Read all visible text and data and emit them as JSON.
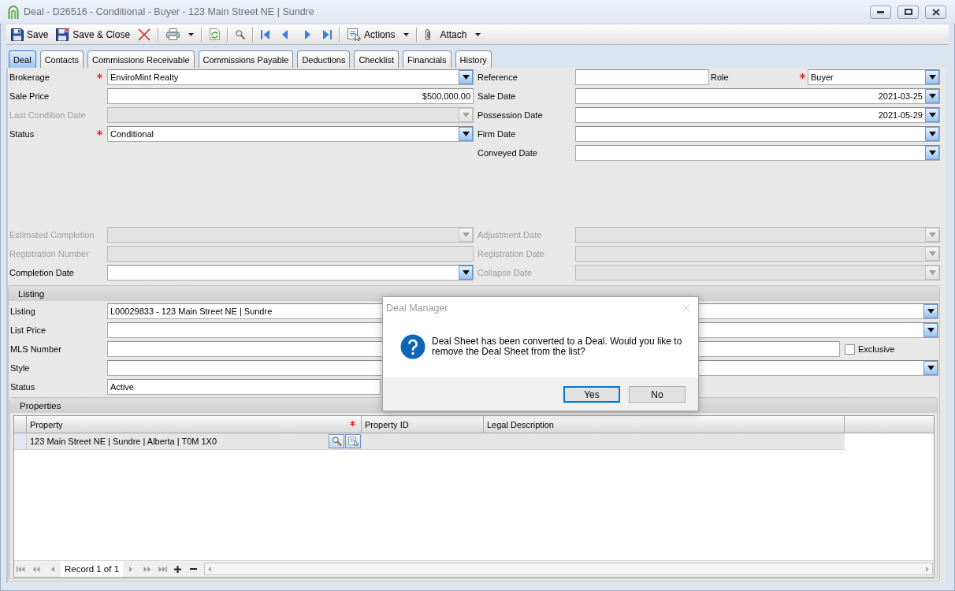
{
  "window": {
    "title": "Deal - D26516 - Conditional - Buyer - 123 Main Street NE | Sundre"
  },
  "toolbar": {
    "groups": [
      [
        {
          "kind": "save",
          "label": "Save",
          "dropdown": false
        },
        {
          "kind": "saveclose",
          "label": "Save & Close",
          "dropdown": false
        },
        {
          "kind": "delete",
          "dropdown": false
        }
      ],
      [
        {
          "kind": "print",
          "dropdown": true
        }
      ],
      [
        {
          "kind": "refresh",
          "dropdown": false
        }
      ],
      [
        {
          "kind": "find",
          "dropdown": false
        }
      ],
      [
        {
          "kind": "first",
          "dropdown": false
        },
        {
          "kind": "previous",
          "dropdown": false
        },
        {
          "kind": "next",
          "dropdown": false
        },
        {
          "kind": "last",
          "dropdown": false
        }
      ],
      [
        {
          "kind": "actions",
          "label": "Actions",
          "dropdown": true
        }
      ],
      [
        {
          "kind": "attach",
          "label": "Attach",
          "dropdown": true
        }
      ]
    ]
  },
  "tabs": [
    {
      "label": "Deal",
      "selected": true
    },
    {
      "label": "Contacts",
      "selected": false
    },
    {
      "label": "Commissions Receivable",
      "selected": false
    },
    {
      "label": "Commissions Payable",
      "selected": false
    },
    {
      "label": "Deductions",
      "selected": false
    },
    {
      "label": "Checklist",
      "selected": false
    },
    {
      "label": "Financials",
      "selected": false
    },
    {
      "label": "History",
      "selected": false
    }
  ],
  "deal_form": {
    "sections": [
      {
        "left": [
          {
            "label": "Brokerage",
            "required": true,
            "disabled": false,
            "kind": "combo",
            "value": "EnviroMint Realty"
          },
          {
            "label": "Sale Price",
            "required": false,
            "disabled": false,
            "kind": "money",
            "value": "$500,000.00"
          },
          {
            "label": "Last Condition Date",
            "required": false,
            "disabled": true,
            "kind": "date"
          },
          {
            "label": "Status",
            "required": true,
            "disabled": false,
            "kind": "combo",
            "value": "Conditional"
          }
        ],
        "right": [
          {
            "label": "Reference",
            "required": false,
            "disabled": false,
            "kind": "short",
            "paired": {
              "label": "Role",
              "required": true,
              "disabled": false,
              "kind": "combo",
              "value": "Buyer"
            }
          },
          {
            "label": "Sale Date",
            "required": false,
            "disabled": false,
            "kind": "date",
            "value": "2021-03-25"
          },
          {
            "label": "Possession Date",
            "required": false,
            "disabled": false,
            "kind": "date",
            "value": "2021-05-29"
          },
          {
            "label": "Firm Date",
            "required": false,
            "disabled": false,
            "kind": "date"
          },
          {
            "label": "Conveyed Date",
            "required": false,
            "disabled": false,
            "kind": "date"
          }
        ]
      },
      {
        "left": [
          {
            "label": "Estimated Completion",
            "required": false,
            "disabled": true,
            "kind": "date"
          },
          {
            "label": "Registration Number",
            "required": false,
            "disabled": true,
            "kind": "text"
          },
          {
            "label": "Completion Date",
            "required": false,
            "disabled": false,
            "kind": "date"
          }
        ],
        "right": [
          {
            "label": "Adjustment Date",
            "required": false,
            "disabled": true,
            "kind": "date"
          },
          {
            "label": "Registration Date",
            "required": false,
            "disabled": true,
            "kind": "date"
          },
          {
            "label": "Collapse Date",
            "required": false,
            "disabled": true,
            "kind": "date"
          }
        ]
      }
    ]
  },
  "listing": {
    "title": "Listing",
    "fields": [
      {
        "label": "Listing",
        "required": false,
        "disabled": false,
        "kind": "combo",
        "value": "L00029833 - 123 Main Street NE | Sundre"
      },
      {
        "label": "List Price",
        "required": false,
        "disabled": false,
        "kind": "combo"
      },
      {
        "label": "MLS Number",
        "required": false,
        "disabled": false,
        "kind": "text",
        "checkbox": {
          "label": "Exclusive",
          "checked": false
        }
      },
      {
        "label": "Style",
        "required": false,
        "disabled": false,
        "kind": "combo"
      },
      {
        "label": "Status",
        "required": false,
        "disabled": false,
        "kind": "short",
        "value": "Active"
      }
    ],
    "properties": {
      "title": "Properties",
      "columns": [
        {
          "label": "Property",
          "required": true
        },
        {
          "label": "Property ID",
          "required": false
        },
        {
          "label": "Legal Description",
          "required": false
        }
      ],
      "rows": [
        {
          "cells": [
            "123 Main Street NE | Sundre | Alberta | T0M 1X0"
          ]
        }
      ],
      "record_counter": "Record 1 of 1"
    }
  },
  "dialog": {
    "title": "Deal Manager",
    "message": "Deal Sheet has been converted to a Deal. Would you like to remove the Deal Sheet from the list?",
    "buttons": [
      {
        "label": "Yes",
        "focused": true
      },
      {
        "label": "No",
        "focused": false
      }
    ]
  }
}
